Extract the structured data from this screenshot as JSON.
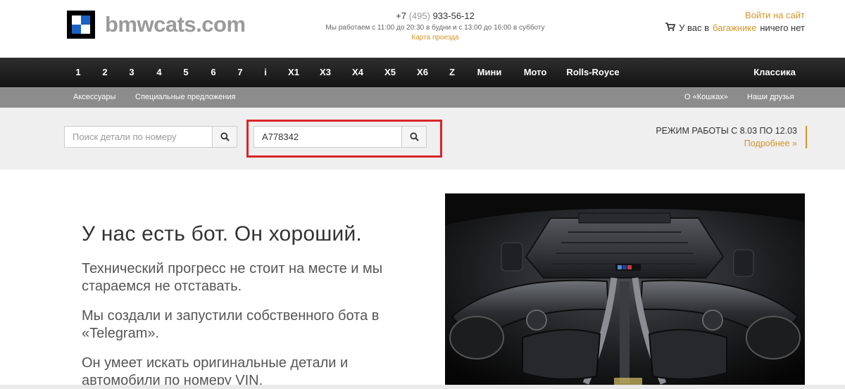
{
  "header": {
    "logo_text": "bmwcats.com",
    "phone_prefix": "+7",
    "phone_code": "(495)",
    "phone_number": "933-56-12",
    "hours": "Мы работаем с 11:00 до 20:30 в будни и с 13:00 до 16:00 в субботу",
    "map_link": "Карта проезда",
    "login_label": "Войти на сайт",
    "cart_prefix": "У вас в",
    "cart_link": "багажнике",
    "cart_suffix": "ничего нет"
  },
  "nav": {
    "items": [
      "1",
      "2",
      "3",
      "4",
      "5",
      "6",
      "7",
      "i",
      "X1",
      "X3",
      "X4",
      "X5",
      "X6",
      "Z",
      "Мини",
      "Мото",
      "Rolls-Royce",
      "Классика"
    ]
  },
  "subnav": {
    "left": [
      "Аксессуары",
      "Специальные предложения"
    ],
    "right": [
      "О «Кошках»",
      "Наши друзья"
    ]
  },
  "search": {
    "part_placeholder": "Поиск детали по номеру",
    "vin_value": "A778342"
  },
  "schedule": {
    "title": "РЕЖИМ РАБОТЫ С 8.03 по 12.03",
    "more": "Подробнее »"
  },
  "promo": {
    "heading": "У нас есть бот. Он хороший.",
    "paragraphs": [
      "Технический прогресс не стоит на месте и мы стараемся не отставать.",
      "Мы создали и запустили собственного бота в «Telegram».",
      "Он умеет искать оригинальные детали и автомобили по номеру VIN."
    ]
  },
  "colors": {
    "accent": "#d4942a",
    "highlight": "#d9242a",
    "nav_bg": "#1e1e1e",
    "subnav_bg": "#8c8c8c",
    "band_bg": "#efefef"
  },
  "icons": [
    "search-icon",
    "cart-icon",
    "bmw-roundel-logo"
  ]
}
